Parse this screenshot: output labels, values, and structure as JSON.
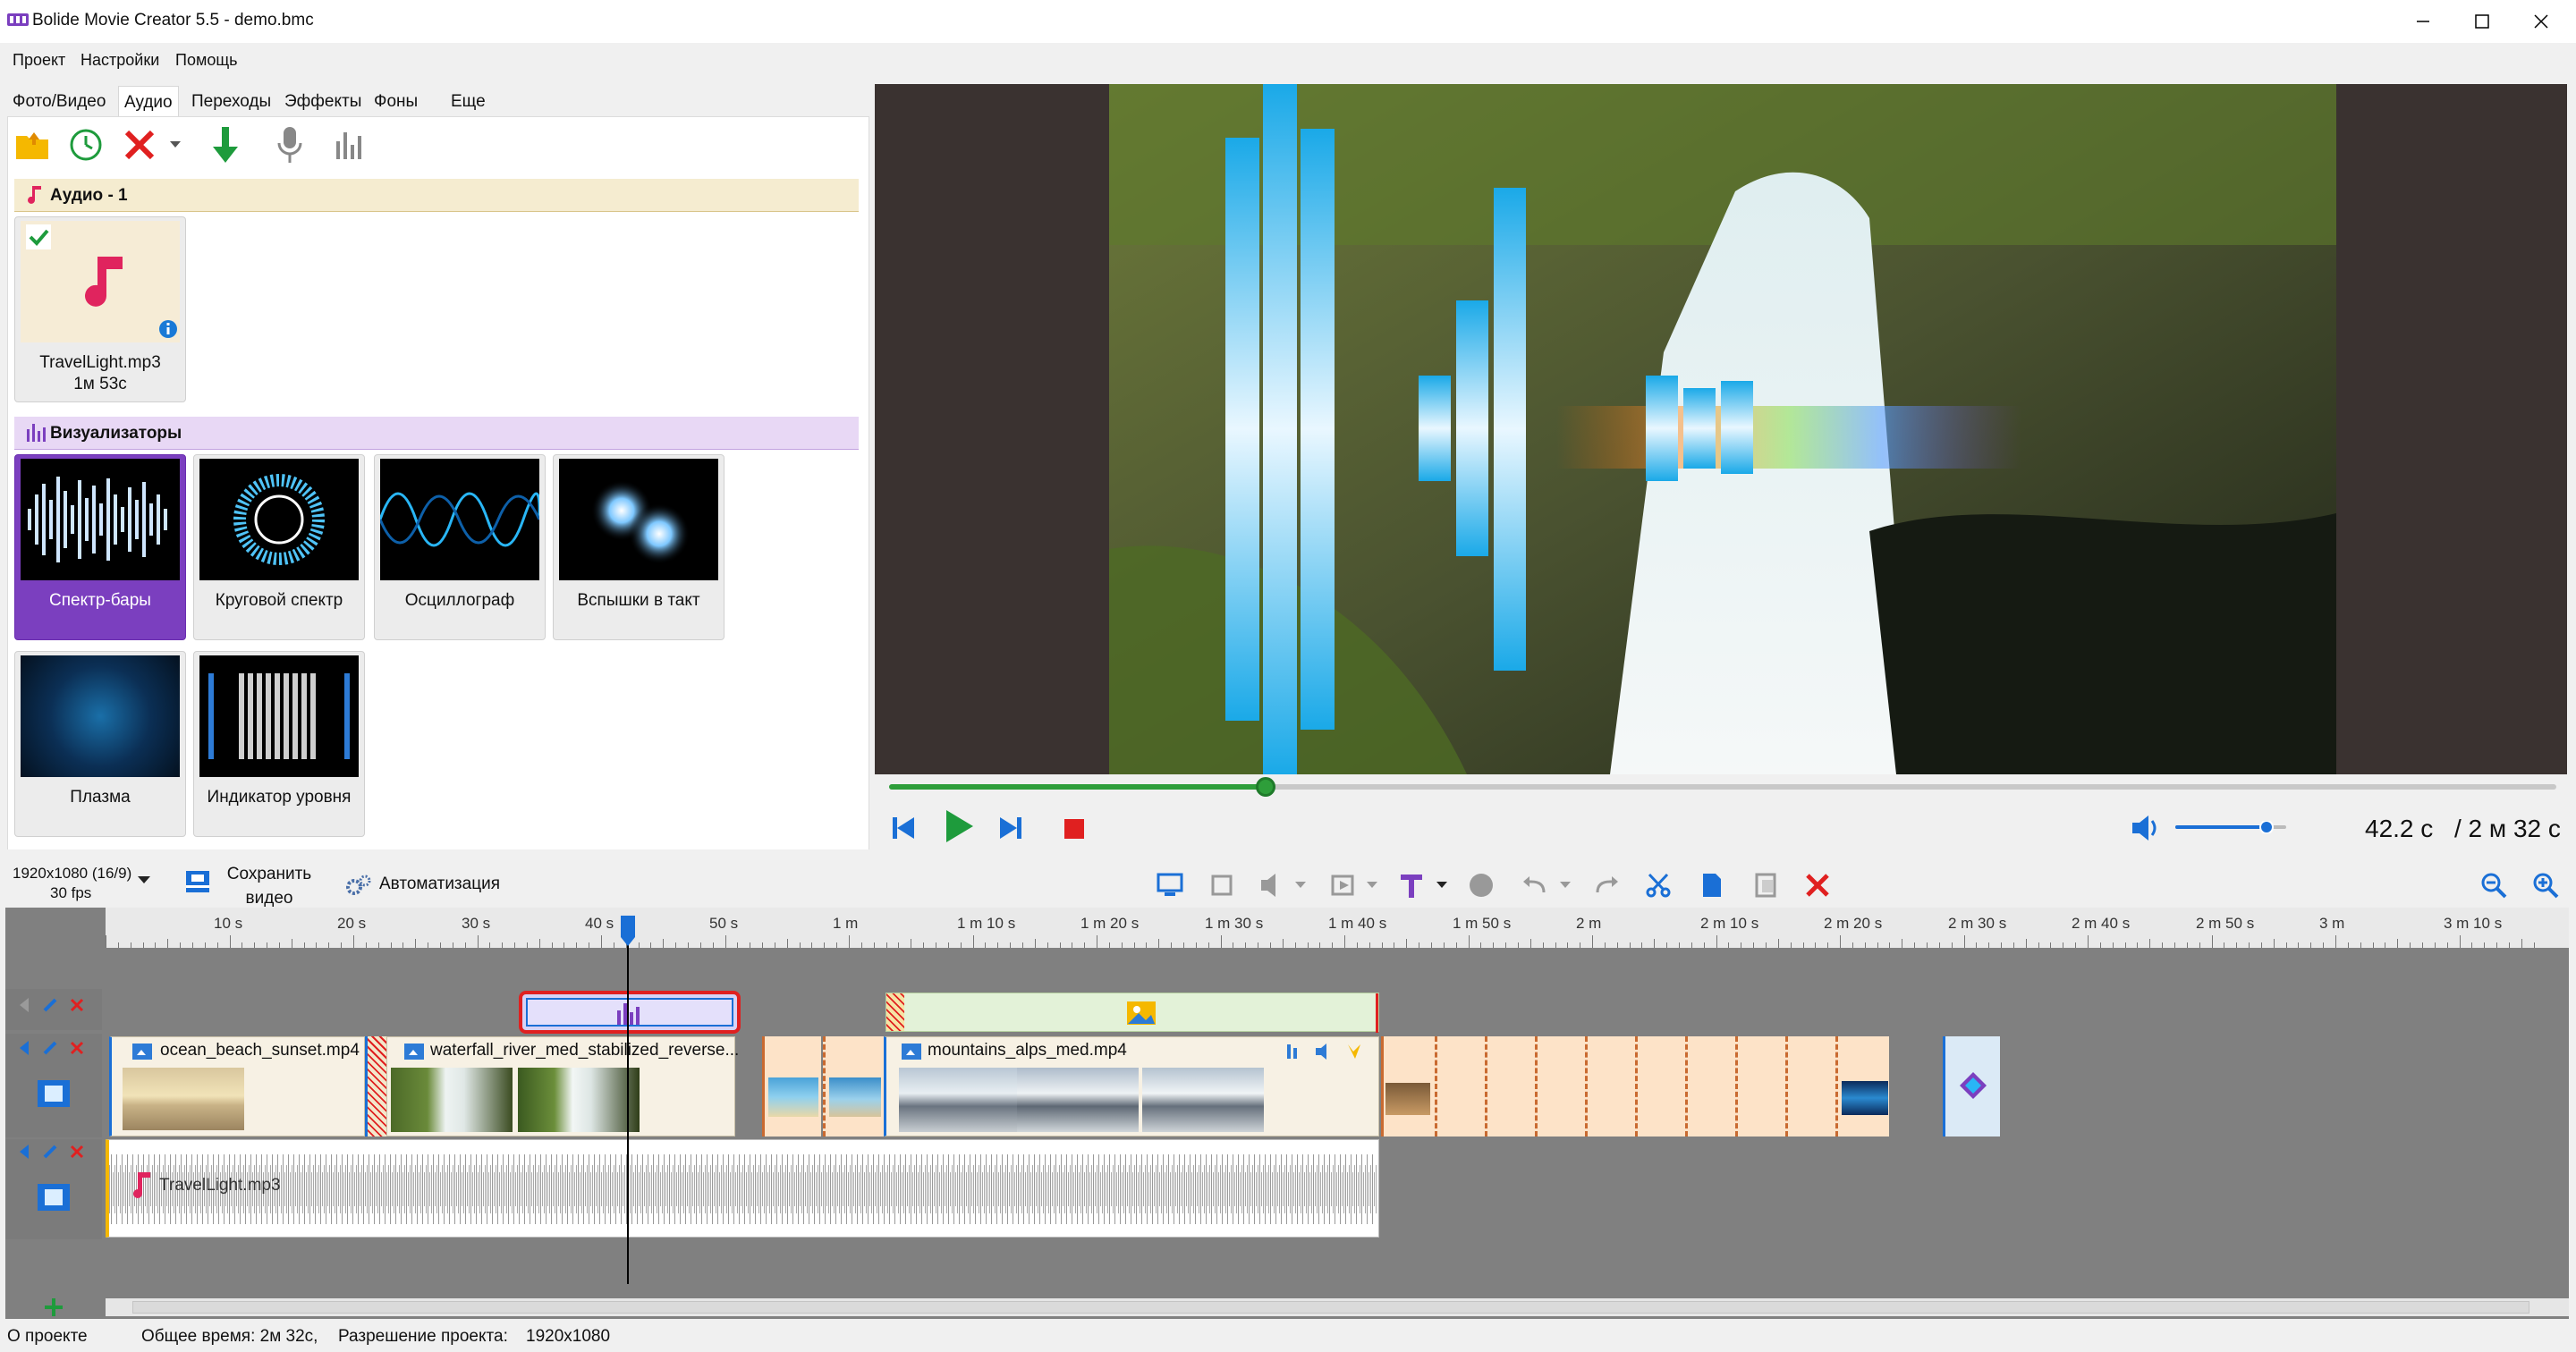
{
  "window": {
    "title": "Bolide Movie Creator 5.5 - demo.bmc"
  },
  "menu": {
    "project": "Проект",
    "settings": "Настройки",
    "help": "Помощь"
  },
  "tabs": [
    "Фото/Видео",
    "Аудио",
    "Переходы",
    "Эффекты",
    "Фоны",
    "Еще"
  ],
  "active_tab": "Аудио",
  "audio_section": {
    "title": "Аудио - 1"
  },
  "audio_item": {
    "name": "TravelLight.mp3",
    "duration": "1м 53с"
  },
  "visualizer_section": {
    "title": "Визуализаторы"
  },
  "visualizers": [
    "Спектр-бары",
    "Круговой спектр",
    "Осциллограф",
    "Вспышки в такт",
    "Плазма",
    "Индикатор уровня"
  ],
  "selected_visualizer": "Спектр-бары",
  "playback": {
    "current_time": "42.2 с",
    "total_time": "/ 2 м 32 с",
    "progress": 0.226,
    "volume": 0.82
  },
  "project": {
    "resolution": "1920x1080 (16/9)",
    "fps": "30 fps",
    "save_line1": "Сохранить",
    "save_line2": "видео",
    "automation": "Автоматизация"
  },
  "ruler_labels": [
    "10 s",
    "20 s",
    "30 s",
    "40 s",
    "50 s",
    "1 m",
    "1 m 10 s",
    "1 m 20 s",
    "1 m 30 s",
    "1 m 40 s",
    "1 m 50 s",
    "2 m",
    "2 m 10 s",
    "2 m 20 s",
    "2 m 30 s",
    "2 m 40 s",
    "2 m 50 s",
    "3 m",
    "3 m 10 s"
  ],
  "clips": {
    "video1": "ocean_beach_sunset.mp4",
    "video2": "waterfall_river_med_stabilized_reverse...",
    "video3": "mountains_alps_med.mp4",
    "audio": "TravelLight.mp3"
  },
  "status": {
    "about": "О проекте",
    "total_time": "Общее время: 2м 32с,",
    "resolution": "Разрешение проекта:",
    "resolution_value": "1920x1080"
  },
  "colors": {
    "accent_purple": "#7b3fbf",
    "progress_green": "#2e9e3a",
    "play_green": "#1e9b3c",
    "stop_red": "#e02020",
    "bar_blue": "#1aa9e8"
  }
}
